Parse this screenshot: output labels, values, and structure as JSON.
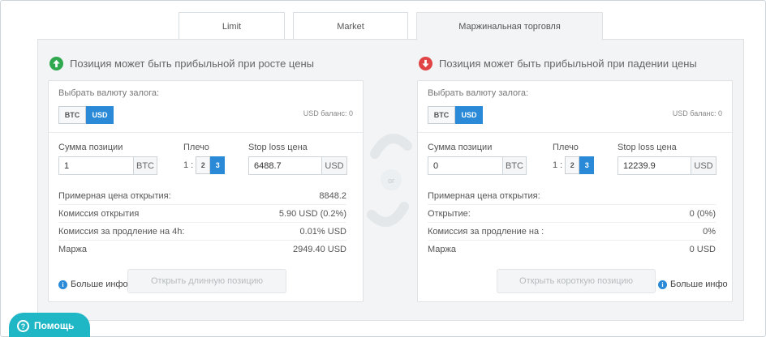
{
  "tabs": [
    {
      "label": "Limit",
      "active": false
    },
    {
      "label": "Market",
      "active": false
    },
    {
      "label": "Маржинальная торговля",
      "active": true
    }
  ],
  "long": {
    "title": "Позиция может быть прибыльной при росте цены",
    "arrow_color": "#2fa84f",
    "collateral_label": "Выбрать валюту залога:",
    "currency_options": [
      "BTC",
      "USD"
    ],
    "selected_currency": "USD",
    "balance": "USD баланс: 0",
    "position_label": "Сумма позиции",
    "position_value": "1",
    "position_unit": "BTC",
    "leverage_label": "Плечо",
    "leverage_prefix": "1 :",
    "leverage_options": [
      "2",
      "3"
    ],
    "selected_leverage": "3",
    "stoploss_label": "Stop loss цена",
    "stoploss_value": "6488.7",
    "stoploss_unit": "USD",
    "rows": [
      {
        "label": "Примерная цена открытия:",
        "value": "8848.2"
      },
      {
        "label": "Комиссия открытия",
        "value": "5.90 USD (0.2%)"
      },
      {
        "label": "Комиссия за продление на 4h:",
        "value": "0.01% USD"
      },
      {
        "label": "Маржа",
        "value": "2949.40 USD"
      }
    ],
    "more_info": "Больше инфо",
    "action": "Открыть длинную позицию"
  },
  "short": {
    "title": "Позиция может быть прибыльной при падении цены",
    "arrow_color": "#e04444",
    "collateral_label": "Выбрать валюту залога:",
    "currency_options": [
      "BTC",
      "USD"
    ],
    "selected_currency": "USD",
    "balance": "USD баланс: 0",
    "position_label": "Сумма позиции",
    "position_value": "0",
    "position_unit": "BTC",
    "leverage_label": "Плечо",
    "leverage_prefix": "1 :",
    "leverage_options": [
      "2",
      "3"
    ],
    "selected_leverage": "3",
    "stoploss_label": "Stop loss цена",
    "stoploss_value": "12239.9",
    "stoploss_unit": "USD",
    "rows": [
      {
        "label": "Примерная цена открытия:",
        "value": ""
      },
      {
        "label": "Открытие:",
        "value": "0 (0%)"
      },
      {
        "label": "Комиссия за продление на :",
        "value": "0%"
      },
      {
        "label": "Маржа",
        "value": "0 USD"
      }
    ],
    "more_info": "Больше инфо",
    "action": "Открыть короткую позицию"
  },
  "swap_text": "or",
  "help_label": "Помощь",
  "accent_color": "#2a8ad8",
  "help_color": "#1fb6c5"
}
